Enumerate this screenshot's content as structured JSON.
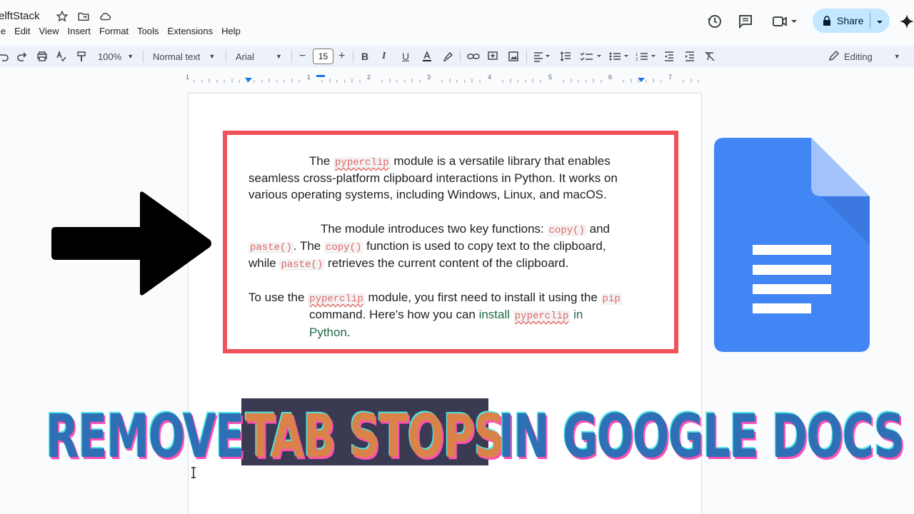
{
  "doc": {
    "title": "elftStack"
  },
  "menu": [
    "le",
    "Edit",
    "View",
    "Insert",
    "Format",
    "Tools",
    "Extensions",
    "Help"
  ],
  "header": {
    "share_label": "Share"
  },
  "toolbar": {
    "zoom": "100%",
    "style": "Normal text",
    "font": "Arial",
    "font_size": "15",
    "mode": "Editing"
  },
  "ruler": {
    "numbers": [
      "1",
      "1",
      "2",
      "3",
      "4",
      "5",
      "6",
      "7"
    ]
  },
  "content": {
    "p1": {
      "a": "The ",
      "code1": "pyperclip",
      "b": " module is a versatile library that enables",
      "line2": "seamless cross-platform clipboard interactions in Python. It works on",
      "line3": "various operating systems, including Windows, Linux, and macOS."
    },
    "p2": {
      "a": "The module introduces two key functions: ",
      "code1": "copy()",
      "b": " and",
      "code2": "paste()",
      "c": ". The ",
      "code3": "copy()",
      "d": " function is used to copy text to the clipboard,",
      "e": "while ",
      "code4": "paste()",
      "f": " retrieves the current content of the clipboard."
    },
    "p3": {
      "a": "To use the ",
      "code1": "pyperclip",
      "b": " module, you first need to install it using the ",
      "code2": "pip",
      "c": "command. Here's how you can ",
      "link1": "install",
      "code3": "pyperclip",
      "link2": " in",
      "link3": "Python",
      "d": "."
    }
  },
  "banner": {
    "w1": "REMOVE",
    "w2": "TAB STOPS",
    "w3": "IN GOOGLE DOCS"
  },
  "colors": {
    "accent_red": "#f0525a",
    "banner_blue": "#2f6fb5",
    "banner_orange": "#d9834a",
    "docs_blue": "#4285f4",
    "share_bg": "#c2e7ff"
  },
  "icons": [
    "star-icon",
    "move-folder-icon",
    "cloud-icon",
    "history-icon",
    "comment-icon",
    "meet-icon",
    "lock-icon",
    "gemini-icon",
    "undo-icon",
    "redo-icon",
    "print-icon",
    "spellcheck-icon",
    "paint-format-icon",
    "bold-icon",
    "italic-icon",
    "underline-icon",
    "text-color-icon",
    "highlight-icon",
    "link-icon",
    "add-comment-icon",
    "image-icon",
    "align-icon",
    "line-spacing-icon",
    "checklist-icon",
    "bulleted-list-icon",
    "numbered-list-icon",
    "decrease-indent-icon",
    "increase-indent-icon",
    "clear-format-icon",
    "pencil-icon",
    "arrow-right-icon",
    "google-docs-logo"
  ]
}
